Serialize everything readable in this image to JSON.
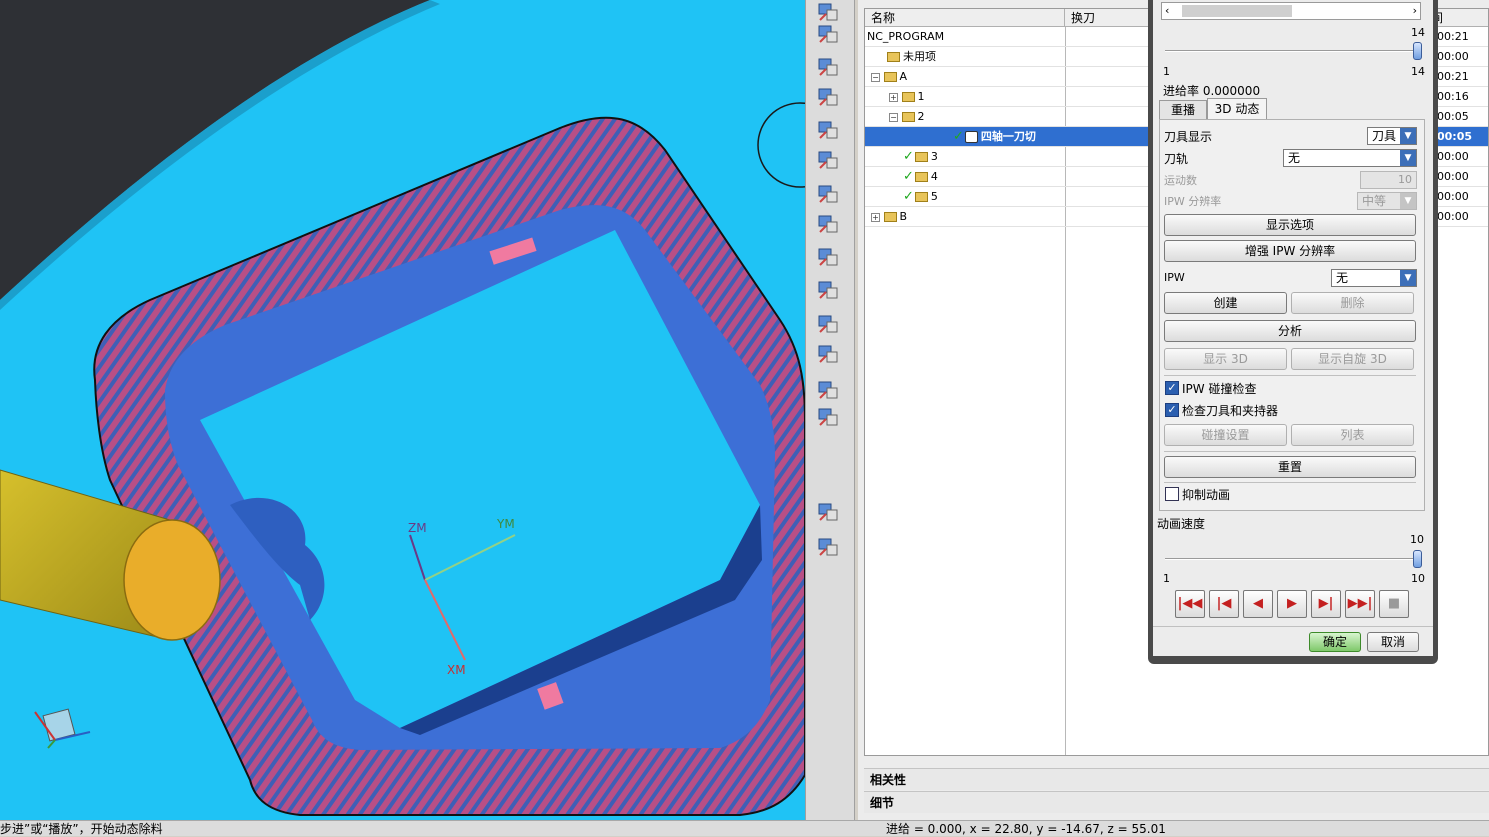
{
  "viewport": {
    "axes": {
      "zm": "ZM",
      "ym": "YM",
      "xm": "XM"
    }
  },
  "toolbar": {
    "icons": [
      "program-order-view-icon",
      "machine-tool-view-icon",
      "geometry-view-icon",
      "method-view-icon",
      "create-program-icon",
      "create-tool-icon",
      "create-geometry-icon",
      "create-method-icon",
      "create-operation-icon",
      "generate-toolpath-icon",
      "verify-toolpath-icon",
      "simulate-machine-icon",
      "show-toolpath-icon",
      "postprocess-icon",
      "shop-documentation-icon",
      "display-options-icon"
    ]
  },
  "tree": {
    "columns": {
      "name": "名称",
      "tool_change": "换刀",
      "time": "间"
    },
    "rows": [
      {
        "label": "NC_PROGRAM",
        "time": "00:21"
      },
      {
        "label": "未用项",
        "time": "00:00"
      },
      {
        "label": "A",
        "time": "00:21"
      },
      {
        "label": "1",
        "time": "00:16"
      },
      {
        "label": "2",
        "time": "00:05"
      },
      {
        "label": "四轴一刀切",
        "time": "00:05"
      },
      {
        "label": "3",
        "time": "00:00"
      },
      {
        "label": "4",
        "time": "00:00"
      },
      {
        "label": "5",
        "time": "00:00"
      },
      {
        "label": "B",
        "time": "00:00"
      }
    ],
    "sections": {
      "dependencies": "相关性",
      "details": "细节"
    }
  },
  "dialog": {
    "feed_slider": {
      "min": "1",
      "max": "14",
      "current": "14"
    },
    "feed_rate_label": "进给率 0.000000",
    "tabs": {
      "replay": "重播",
      "dynamic3d": "3D 动态"
    },
    "tool_display": {
      "label": "刀具显示",
      "value": "刀具"
    },
    "toolpath": {
      "label": "刀轨",
      "value": "无"
    },
    "motion_count": {
      "label": "运动数",
      "value": "10"
    },
    "ipw_resolution": {
      "label": "IPW 分辨率",
      "value": "中等"
    },
    "buttons": {
      "display_options": "显示选项",
      "enhance_ipw": "增强 IPW 分辨率",
      "create": "创建",
      "delete": "删除",
      "analyze": "分析",
      "show_3d": "显示 3D",
      "show_spin_3d": "显示自旋 3D",
      "collision_settings": "碰撞设置",
      "list": "列表",
      "reset": "重置",
      "ok": "确定",
      "cancel": "取消"
    },
    "ipw": {
      "label": "IPW",
      "value": "无"
    },
    "checkboxes": {
      "ipw_collision": "IPW 碰撞检查",
      "check_tool_holder": "检查刀具和夹持器",
      "suppress_animation": "抑制动画"
    },
    "checkbox_states": {
      "ipw_collision": true,
      "check_tool_holder": true,
      "suppress_animation": false
    },
    "anim_speed": {
      "label": "动画速度",
      "min": "1",
      "max": "10",
      "current": "10"
    },
    "vcr_icons": [
      "rewind-to-start-icon",
      "step-back-icon",
      "play-backward-icon",
      "play-forward-icon",
      "step-forward-icon",
      "fast-forward-icon",
      "stop-icon"
    ]
  },
  "status": {
    "left": "步进”或“播放”，开始动态除料",
    "right": "进给 = 0.000, x = 22.80, y = -14.67, z = 55.01"
  },
  "colors": {
    "stock": "#1fc3f5",
    "part": "#3d6fd6",
    "gouge": "#c0507a",
    "tool": "#c8b22a",
    "selected_row": "#2f6fd0"
  }
}
